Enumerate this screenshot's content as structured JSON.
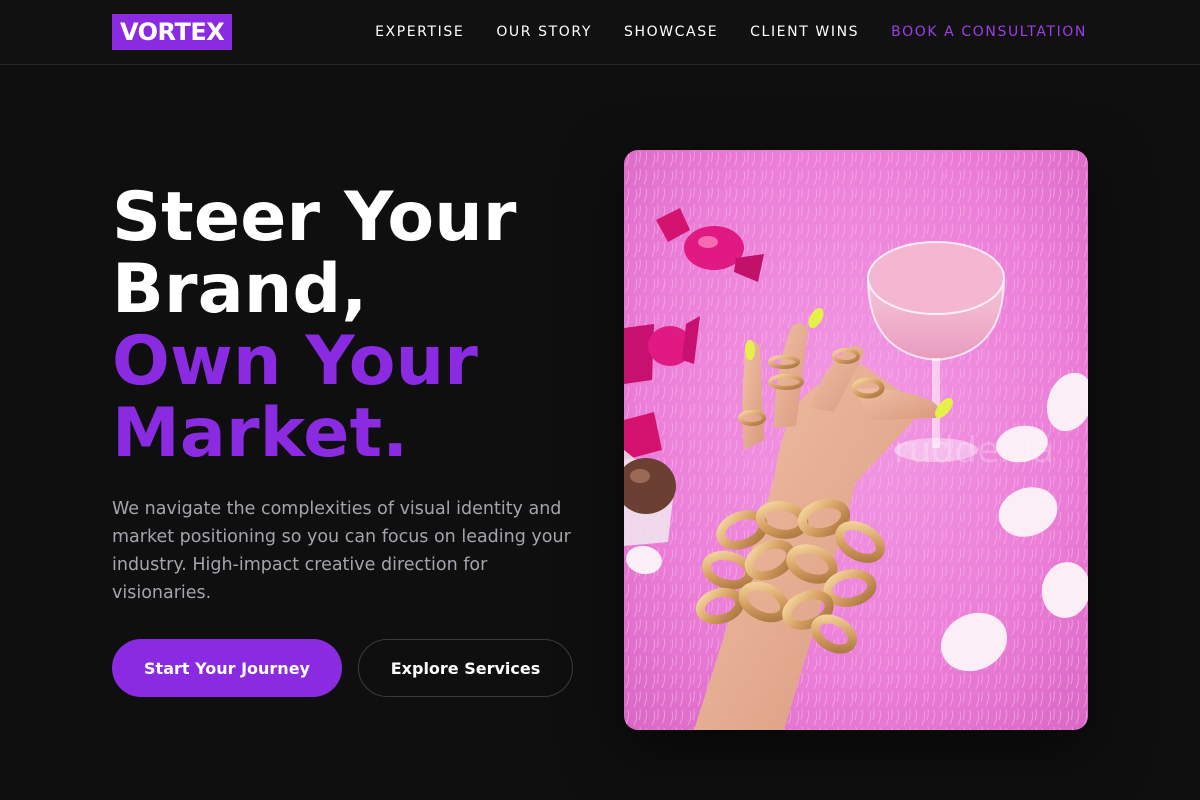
{
  "brand": {
    "logo_text": "VORTEX",
    "accent_color": "#8a2be2"
  },
  "nav": {
    "items": [
      "EXPERTISE",
      "OUR STORY",
      "SHOWCASE",
      "CLIENT WINS"
    ],
    "cta": "BOOK A CONSULTATION"
  },
  "hero": {
    "headline_line1": "Steer Your",
    "headline_line2": "Brand,",
    "headline_line3": "Own Your",
    "headline_line4": "Market.",
    "subtext": "We navigate the complexities of visual identity and market positioning so you can focus on leading your industry. High-impact creative direction for visionaries.",
    "primary_button": "Start Your Journey",
    "secondary_button": "Explore Services",
    "image": {
      "watermark": "rudder.la",
      "background_color": "#ec7fd8"
    }
  }
}
